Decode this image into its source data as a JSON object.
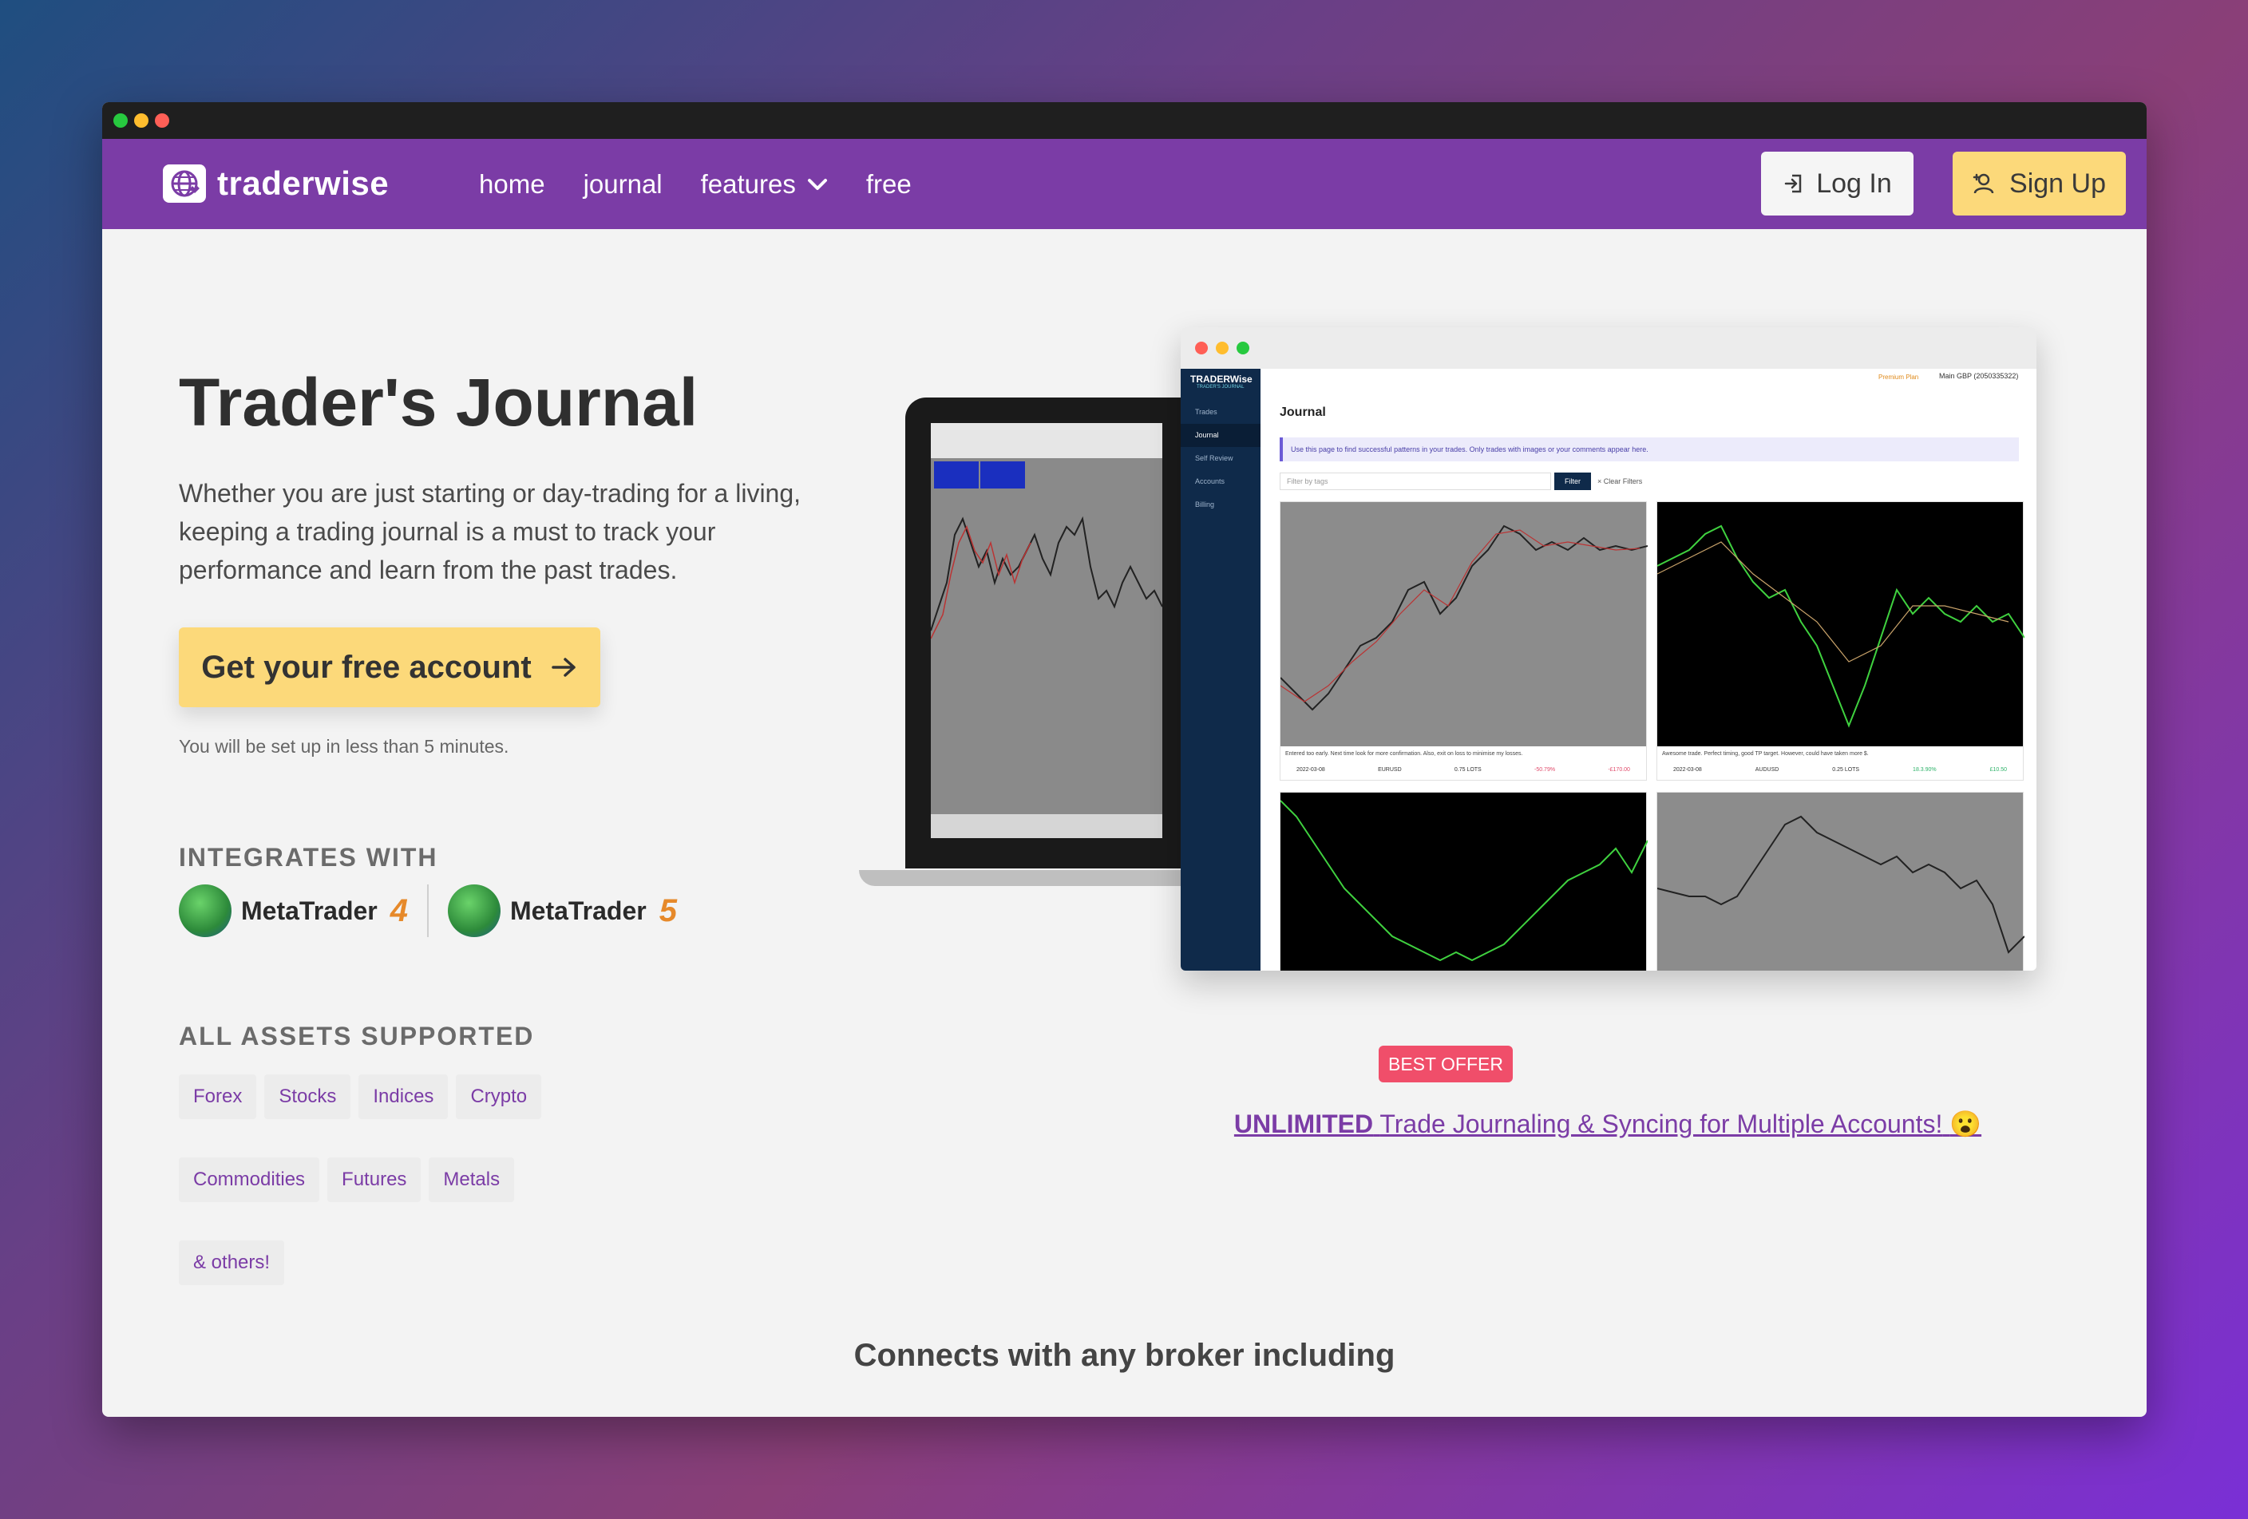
{
  "nav": {
    "brand": "traderwise",
    "links": [
      {
        "label": "home"
      },
      {
        "label": "journal"
      },
      {
        "label": "features"
      },
      {
        "label": "free"
      }
    ],
    "login_label": "Log In",
    "signup_label": "Sign Up"
  },
  "hero": {
    "title": "Trader's Journal",
    "description": "Whether you are just starting or day-trading for a living, keeping a trading journal is a must to track your performance and learn from the past trades.",
    "cta_label": "Get your free account",
    "setup_note": "You will be set up in less than 5 minutes."
  },
  "integrations": {
    "heading": "INTEGRATES WITH",
    "platforms": [
      {
        "name": "MetaTrader",
        "version": "4"
      },
      {
        "name": "MetaTrader",
        "version": "5"
      }
    ]
  },
  "assets": {
    "heading": "ALL ASSETS SUPPORTED",
    "tags": [
      "Forex",
      "Stocks",
      "Indices",
      "Crypto",
      "Commodities",
      "Futures",
      "Metals",
      "& others!"
    ]
  },
  "app_preview": {
    "brand": "TRADERWise",
    "brand_sub": "TRADER'S JOURNAL",
    "sidebar": [
      "Trades",
      "Journal",
      "Self Review",
      "Accounts",
      "Billing"
    ],
    "heading": "Journal",
    "info": "Use this page to find successful patterns in your trades. Only trades with images or your comments appear here.",
    "filter_placeholder": "Filter by tags",
    "filter_button": "Filter",
    "clear_filters": "× Clear Filters",
    "plan_badge": "Premium Plan",
    "account_select": "Main GBP (2050335322)",
    "cards": [
      {
        "note": "Entered too early. Next time look for more confirmation. Also, exit on loss to minimise my losses.",
        "date": "2022-03-08",
        "pair": "EURUSD",
        "lots": "0.75 LOTS",
        "pct": "-50.79%",
        "pnl": "-£170.00"
      },
      {
        "note": "Awesome trade. Perfect timing, good TP target. However, could have taken more $.",
        "date": "2022-03-08",
        "pair": "AUDUSD",
        "lots": "0.25 LOTS",
        "pct": "18.3.90%",
        "pnl": "£10.50"
      }
    ]
  },
  "offer": {
    "badge": "BEST OFFER",
    "highlight": "UNLIMITED",
    "text": "Trade Journaling & Syncing for Multiple Accounts!",
    "emoji": "😮"
  },
  "connects": "Connects with any broker including",
  "colors": {
    "nav_bg": "#7b3ca6",
    "accent_yellow": "#fcd97a",
    "offer_red": "#f04e6a",
    "purple_text": "#7b3ca6"
  },
  "icons": {
    "login": "log-in-icon",
    "signup": "user-plus-icon",
    "cta_arrow": "arrow-right-icon",
    "features_chevron": "chevron-down-icon"
  }
}
